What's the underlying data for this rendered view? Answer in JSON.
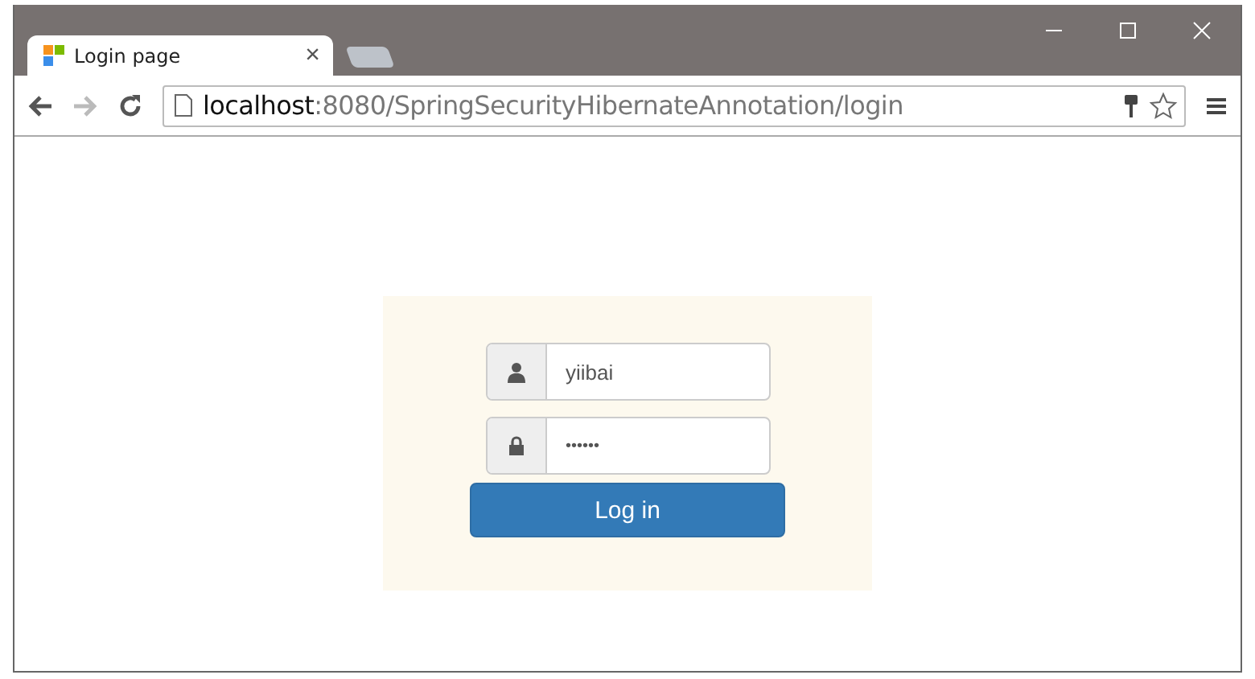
{
  "tabs": [
    {
      "title": "Login page",
      "selected": true,
      "close": "×"
    },
    {
      "selected": false
    }
  ],
  "address_bar": {
    "host": "localhost",
    "path": ":8080/SpringSecurityHibernateAnnotation/login"
  },
  "login_form": {
    "username": {
      "value": "yiibai"
    },
    "password": {
      "value": "••••••"
    },
    "button": "Log in"
  }
}
